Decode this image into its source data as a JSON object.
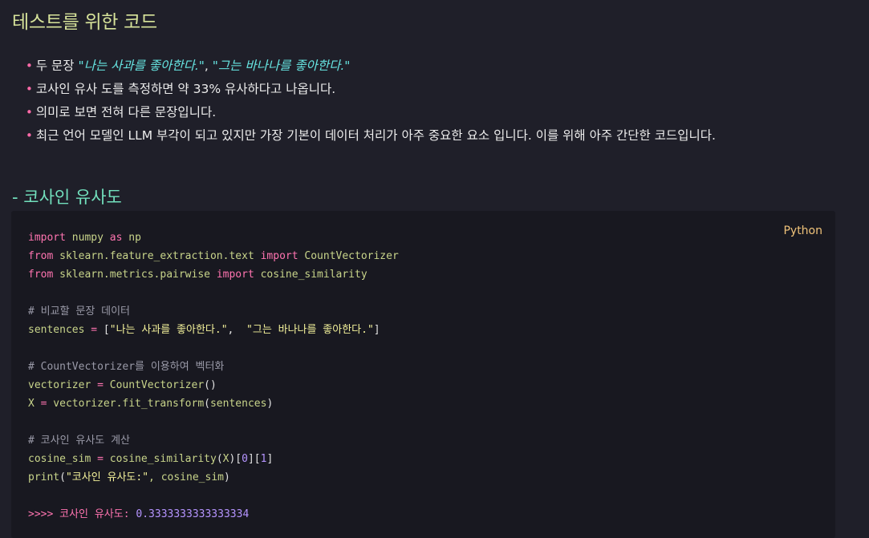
{
  "heading": "테스트를 위한 코드",
  "bullets": {
    "item1_prefix": "두 문장 ",
    "item1_quote1": "\"나는 사과를 좋아한다.\"",
    "item1_sep": ", ",
    "item1_quote2": "\"그는 바나나를 좋아한다.\"",
    "item2": "코사인 유사 도를 측정하면 약 33% 유사하다고 나옵니다.",
    "item3": "의미로 보면 전혀 다른 문장입니다.",
    "item4": "최근 언어 모델인 LLM 부각이 되고 있지만 가장 기본이 데이터 처리가 아주 중요한 요소 입니다. 이를 위해 아주 간단한 코드입니다.",
    "bullet_glyph": "•"
  },
  "subheading": "- 코사인 유사도",
  "code": {
    "language": "Python",
    "l1": {
      "kw1": "import",
      "mod": " numpy ",
      "kw2": "as",
      "alias": " np"
    },
    "l2": {
      "kw1": "from",
      "mod": " sklearn.feature_extraction.text ",
      "kw2": "import",
      "name": " CountVectorizer"
    },
    "l3": {
      "kw1": "from",
      "mod": " sklearn.metrics.pairwise ",
      "kw2": "import",
      "name": " cosine_similarity"
    },
    "l5_comment": "# 비교할 문장 데이터",
    "l6": {
      "var": "sentences ",
      "op": "=",
      "open": " [",
      "s1": "\"나는 사과를 좋아한다.\"",
      "comma": ",  ",
      "s2": "\"그는 바나나를 좋아한다.\"",
      "close": "]"
    },
    "l8_comment": "# CountVectorizer를 이용하여 벡터화",
    "l9": {
      "var": "vectorizer ",
      "op": "=",
      "call": " CountVectorizer",
      "paren": "()"
    },
    "l10": {
      "var": "X ",
      "op": "=",
      "call": " vectorizer.fit_transform",
      "open": "(",
      "arg": "sentences",
      "close": ")"
    },
    "l12_comment": "# 코사인 유사도 계산",
    "l13": {
      "var": "cosine_sim ",
      "op": "=",
      "call": " cosine_similarity",
      "open": "(",
      "arg": "X",
      "close": ")",
      "idx_open1": "[",
      "idx1": "0",
      "idx_close1": "]",
      "idx_open2": "[",
      "idx2": "1",
      "idx_close2": "]"
    },
    "l14": {
      "call": "print",
      "open": "(",
      "str": "\"코사인 유사도:\"",
      "rest": ", cosine_sim",
      "close": ")"
    },
    "output": {
      "prompt": ">>>> ",
      "label": "코사인 유사도: ",
      "value": "0.3333333333333334"
    }
  },
  "colors": {
    "background": "#1f1f29",
    "code_background": "#181820",
    "heading": "#d7e39a",
    "subheading": "#72e0bd",
    "keyword": "#ff74b0",
    "string": "#f3f19a",
    "number": "#b594ff",
    "quote": "#66e3e0"
  }
}
